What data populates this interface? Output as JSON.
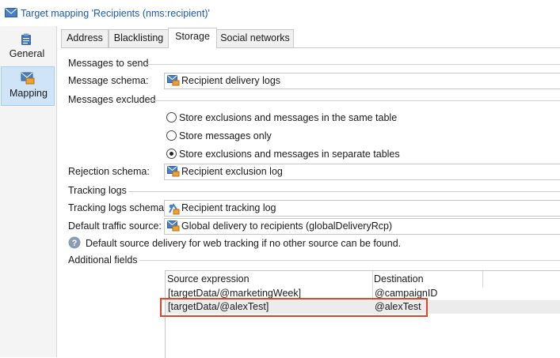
{
  "window": {
    "title": "Target mapping 'Recipients (nms:recipient)'"
  },
  "nav": [
    {
      "label": "General"
    },
    {
      "label": "Mapping"
    }
  ],
  "tabs": [
    "Address",
    "Blacklisting",
    "Storage",
    "Social networks"
  ],
  "active_tab": "Storage",
  "sections": {
    "messages_to_send": "Messages to send",
    "messages_excluded": "Messages excluded",
    "tracking_logs": "Tracking logs",
    "additional_fields": "Additional fields"
  },
  "fields": {
    "message_schema": {
      "label": "Message schema:",
      "value": "Recipient delivery logs"
    },
    "rejection_schema": {
      "label": "Rejection schema:",
      "value": "Recipient exclusion log"
    },
    "tracking_logs_schema": {
      "label": "Tracking logs schema:",
      "value": "Recipient tracking log"
    },
    "default_traffic_source": {
      "label": "Default traffic source:",
      "value": "Global delivery to recipients (globalDeliveryRcp)"
    }
  },
  "radios": [
    {
      "label": "Store exclusions and messages in the same table",
      "selected": false
    },
    {
      "label": "Store messages only",
      "selected": false
    },
    {
      "label": "Store exclusions and messages in separate tables",
      "selected": true
    }
  ],
  "info_text": "Default source delivery for web tracking if no other source can be found.",
  "table": {
    "columns": [
      "Source expression",
      "Destination"
    ],
    "rows": [
      [
        "[targetData/@marketingWeek]",
        "@campaignID"
      ],
      [
        "[targetData/@alexTest]",
        "@alexTest"
      ]
    ],
    "highlighted_row": 1
  },
  "colors": {
    "title": "#1e5aa8",
    "nav_selected": "#cfe5f7",
    "highlight": "#d9462b"
  }
}
